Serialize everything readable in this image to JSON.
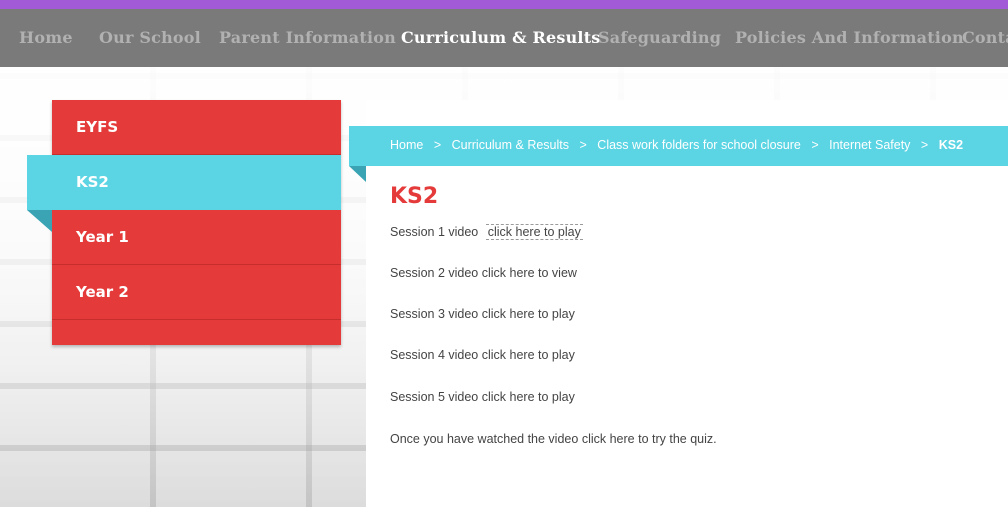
{
  "nav": {
    "items": [
      {
        "label": "Home",
        "active": false
      },
      {
        "label": "Our School",
        "active": false
      },
      {
        "label": "Parent Information",
        "active": false
      },
      {
        "label": "Curriculum & Results",
        "active": true
      },
      {
        "label": "Safeguarding",
        "active": false
      },
      {
        "label": "Policies And Information",
        "active": false
      },
      {
        "label": "Conta",
        "active": false
      }
    ]
  },
  "sidebar": {
    "items": [
      {
        "label": "EYFS",
        "active": false
      },
      {
        "label": "KS2",
        "active": true
      },
      {
        "label": "Year 1",
        "active": false
      },
      {
        "label": "Year 2",
        "active": false
      }
    ]
  },
  "breadcrumb": {
    "items": [
      "Home",
      "Curriculum & Results",
      "Class work folders for school closure",
      "Internet Safety",
      "KS2"
    ],
    "separator": ">"
  },
  "page": {
    "title": "KS2",
    "sessions": [
      {
        "text": "Session 1 video",
        "link": "click here to play"
      },
      {
        "text": "Session 2 video",
        "link": "click here to view"
      },
      {
        "text": "Session 3 video",
        "link": "click here to play"
      },
      {
        "text": "Session 4 video",
        "link": "click here to play"
      },
      {
        "text": "Session 5 video",
        "link": "click here to play"
      }
    ],
    "quiz": {
      "prefix": "Once you have watched the video",
      "link": "click here",
      "suffix": "to try the quiz."
    }
  },
  "colors": {
    "accent_red": "#e53a3a",
    "accent_cyan": "#5bd4e3",
    "nav_bg": "#7a7a7a",
    "top_strip": "#a35ad6"
  }
}
